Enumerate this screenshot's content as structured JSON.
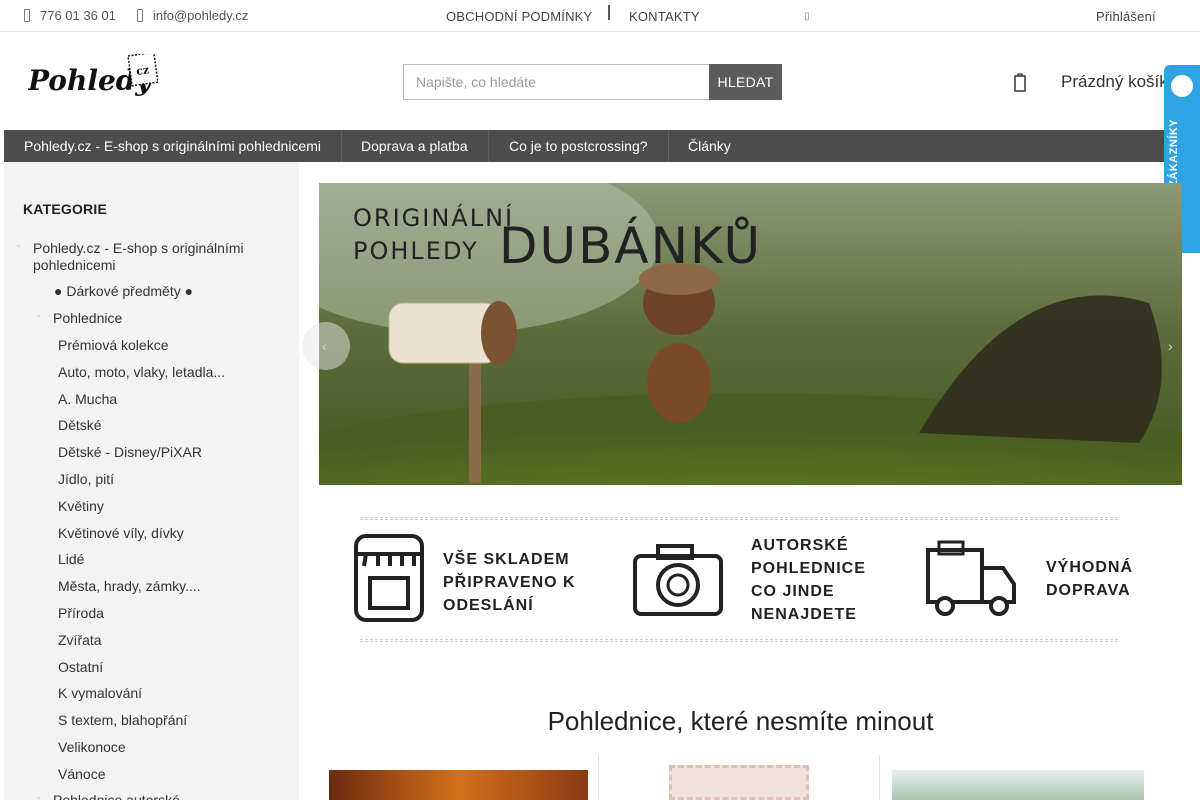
{
  "topbar": {
    "phone": "776 01 36 01",
    "email": "info@pohledy.cz",
    "links": [
      "OBCHODNÍ PODMÍNKY",
      "KONTAKTY"
    ],
    "login": "Přihlášení"
  },
  "header": {
    "logo_text": "Pohledy",
    "logo_badge": "cz",
    "search_placeholder": "Napište, co hledáte",
    "search_button": "HLEDAT",
    "cart_label": "Prázdný košík",
    "verified_label": "OVĚŘENO ZÁKAZNÍKY"
  },
  "nav": {
    "items": [
      "Pohledy.cz - E-shop s originálními pohlednicemi",
      "Doprava a platba",
      "Co je to postcrossing?",
      "Články"
    ]
  },
  "sidebar": {
    "title": "KATEGORIE",
    "root": "Pohledy.cz - E-shop s originálními pohlednicemi",
    "gifts": "● Dárkové předměty ●",
    "postcards": "Pohlednice",
    "subcategories": [
      "Prémiová kolekce",
      "Auto, moto, vlaky, letadla...",
      "A. Mucha",
      "Dětské",
      "Dětské - Disney/PiXAR",
      "Jídlo, pití",
      "Květiny",
      "Květinové víly, dívky",
      "Lidé",
      "Města, hrady, zámky....",
      "Příroda",
      "Zvířata",
      "Ostatní",
      "K vymalování",
      "S textem, blahopřání",
      "Velikonoce",
      "Vánoce"
    ],
    "next": "Pohlednice autorské"
  },
  "banner": {
    "line1": "ORIGINÁLNÍ",
    "line2": "POHLEDY",
    "headline": "DUBÁNKŮ"
  },
  "features": [
    {
      "icon": "shop-icon",
      "lines": [
        "VŠE SKLADEM",
        "PŘIPRAVENO K",
        "ODESLÁNÍ"
      ]
    },
    {
      "icon": "camera-icon",
      "lines": [
        "AUTORSKÉ",
        "POHLEDNICE",
        "CO JINDE",
        "NENAJDETE"
      ]
    },
    {
      "icon": "truck-icon",
      "lines": [
        "VÝHODNÁ",
        "DOPRAVA"
      ]
    }
  ],
  "section_title": "Pohlednice, které nesmíte minout",
  "colors": {
    "nav_bg": "#4d4d4d",
    "search_button_bg": "#5c5c5c",
    "sidebar_bg": "#f3f3f3",
    "verified_bg": "#2fa3e4"
  }
}
